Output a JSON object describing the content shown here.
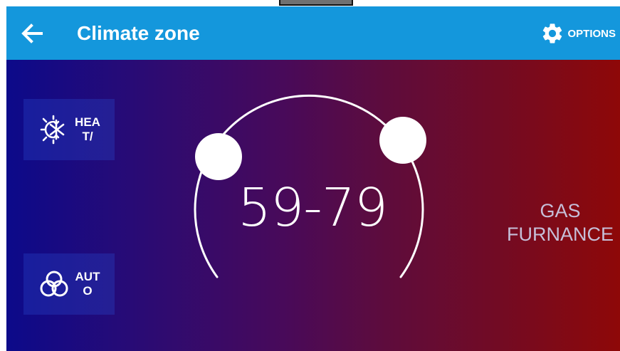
{
  "header": {
    "title": "Climate zone",
    "options_label": "OPTIONS"
  },
  "modes": {
    "heat_cool": {
      "label": "HEAT/",
      "icon": "sun-snowflake-icon"
    },
    "auto": {
      "label": "AUTO",
      "icon": "fan-icon"
    }
  },
  "thermostat": {
    "setpoint_range": "59-79",
    "source": "GAS FURNANCE",
    "source_line1": "GAS",
    "source_line2": "FURNANCE"
  },
  "colors": {
    "header": "#1497dc",
    "gradient_left": "#0c0a8a",
    "gradient_right": "#8e0808",
    "dial": "#ffffff"
  }
}
